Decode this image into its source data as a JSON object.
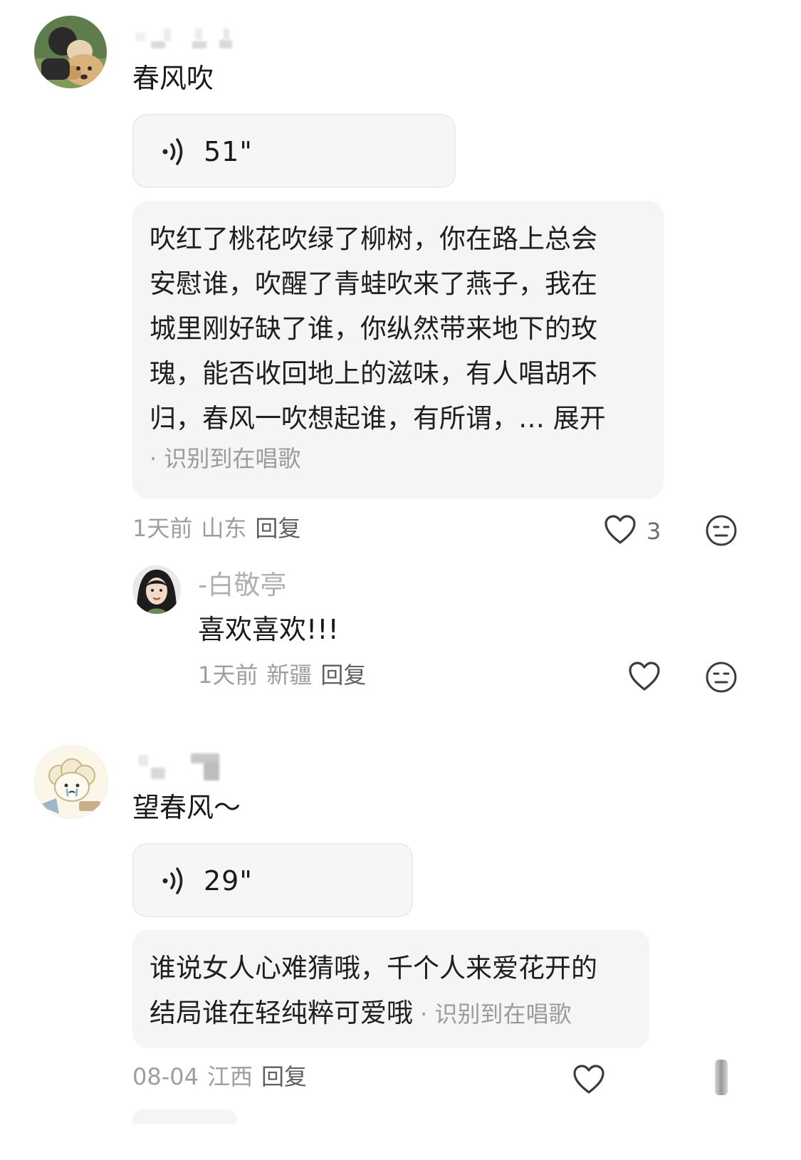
{
  "comments": [
    {
      "text": "春风吹",
      "voice": {
        "duration": "51\""
      },
      "lyrics": {
        "lines": [
          "吹红了桃花吹绿了柳树，你在路上总会",
          "安慰谁，吹醒了青蛙吹来了燕子，我在",
          "城里刚好缺了谁，你纵然带来地下的玫",
          "瑰，能否收回地上的滋味，有人唱胡不",
          "归，春风一吹想起谁，有所谓，… "
        ],
        "expand_label": "展开",
        "recognized_label": "· 识别到在唱歌"
      },
      "meta": {
        "time": "1天前",
        "location": "山东",
        "reply_label": "回复"
      },
      "like_count": "3",
      "replies": [
        {
          "name": "-白敬亭",
          "text": "喜欢喜欢!!!",
          "meta": {
            "time": "1天前",
            "location": "新疆",
            "reply_label": "回复"
          }
        }
      ]
    },
    {
      "text": "望春风～",
      "voice": {
        "duration": "29\""
      },
      "lyrics": {
        "lines": [
          "谁说女人心难猜哦，千个人来爱花开的",
          "结局谁在轻纯粹可爱哦"
        ],
        "recognized_label": " · 识别到在唱歌"
      },
      "meta": {
        "time": "08-04",
        "location": "江西",
        "reply_label": "回复"
      }
    }
  ],
  "icons": {
    "voice": "sound-wave-icon",
    "like": "heart-outline-icon",
    "dislike": "meh-face-icon",
    "scroll": "scrollbar-thumb"
  },
  "colors": {
    "text_primary": "#1a1a1a",
    "text_secondary": "#9e9e9e",
    "card_bg": "#f5f5f5",
    "icon_stroke": "#4a4a4a"
  }
}
